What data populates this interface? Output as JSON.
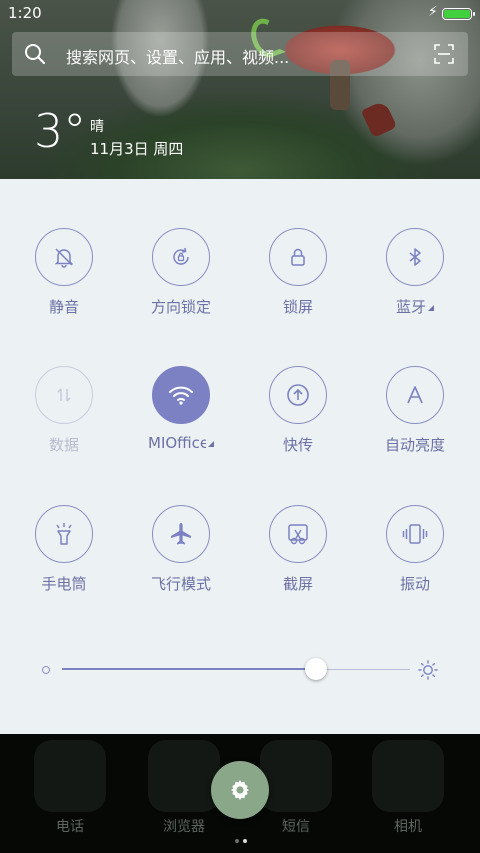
{
  "status_bar": {
    "time": "1:20"
  },
  "search": {
    "placeholder": "搜索网页、设置、应用、视频..."
  },
  "weather": {
    "temperature": "3°",
    "condition": "晴",
    "date": "11月3日 周四"
  },
  "quick_settings": {
    "tiles": [
      {
        "label": "静音",
        "icon": "bell-off-icon",
        "state": "off"
      },
      {
        "label": "方向锁定",
        "icon": "rotation-lock-icon",
        "state": "off"
      },
      {
        "label": "锁屏",
        "icon": "lock-icon",
        "state": "off"
      },
      {
        "label": "蓝牙",
        "icon": "bluetooth-icon",
        "state": "off"
      },
      {
        "label": "数据",
        "icon": "data-arrows-icon",
        "state": "disabled"
      },
      {
        "label": "MIOffice",
        "icon": "wifi-icon",
        "state": "on"
      },
      {
        "label": "快传",
        "icon": "quick-share-icon",
        "state": "off"
      },
      {
        "label": "自动亮度",
        "icon": "auto-brightness-icon",
        "state": "off"
      },
      {
        "label": "手电筒",
        "icon": "flashlight-icon",
        "state": "off"
      },
      {
        "label": "飞行模式",
        "icon": "airplane-icon",
        "state": "off"
      },
      {
        "label": "截屏",
        "icon": "screenshot-icon",
        "state": "off"
      },
      {
        "label": "振动",
        "icon": "vibrate-icon",
        "state": "off"
      }
    ],
    "brightness": {
      "level": 0.73
    }
  },
  "dock": {
    "apps": [
      {
        "label": "电话"
      },
      {
        "label": "浏览器"
      },
      {
        "label": "短信"
      },
      {
        "label": "相机"
      }
    ],
    "page_indicator": {
      "pages": 2,
      "current": 2
    }
  },
  "colors": {
    "accent": "#7b81c3",
    "panel_bg": "#ecf1f3",
    "fab": "#8aa78a",
    "battery": "#41d13f"
  }
}
